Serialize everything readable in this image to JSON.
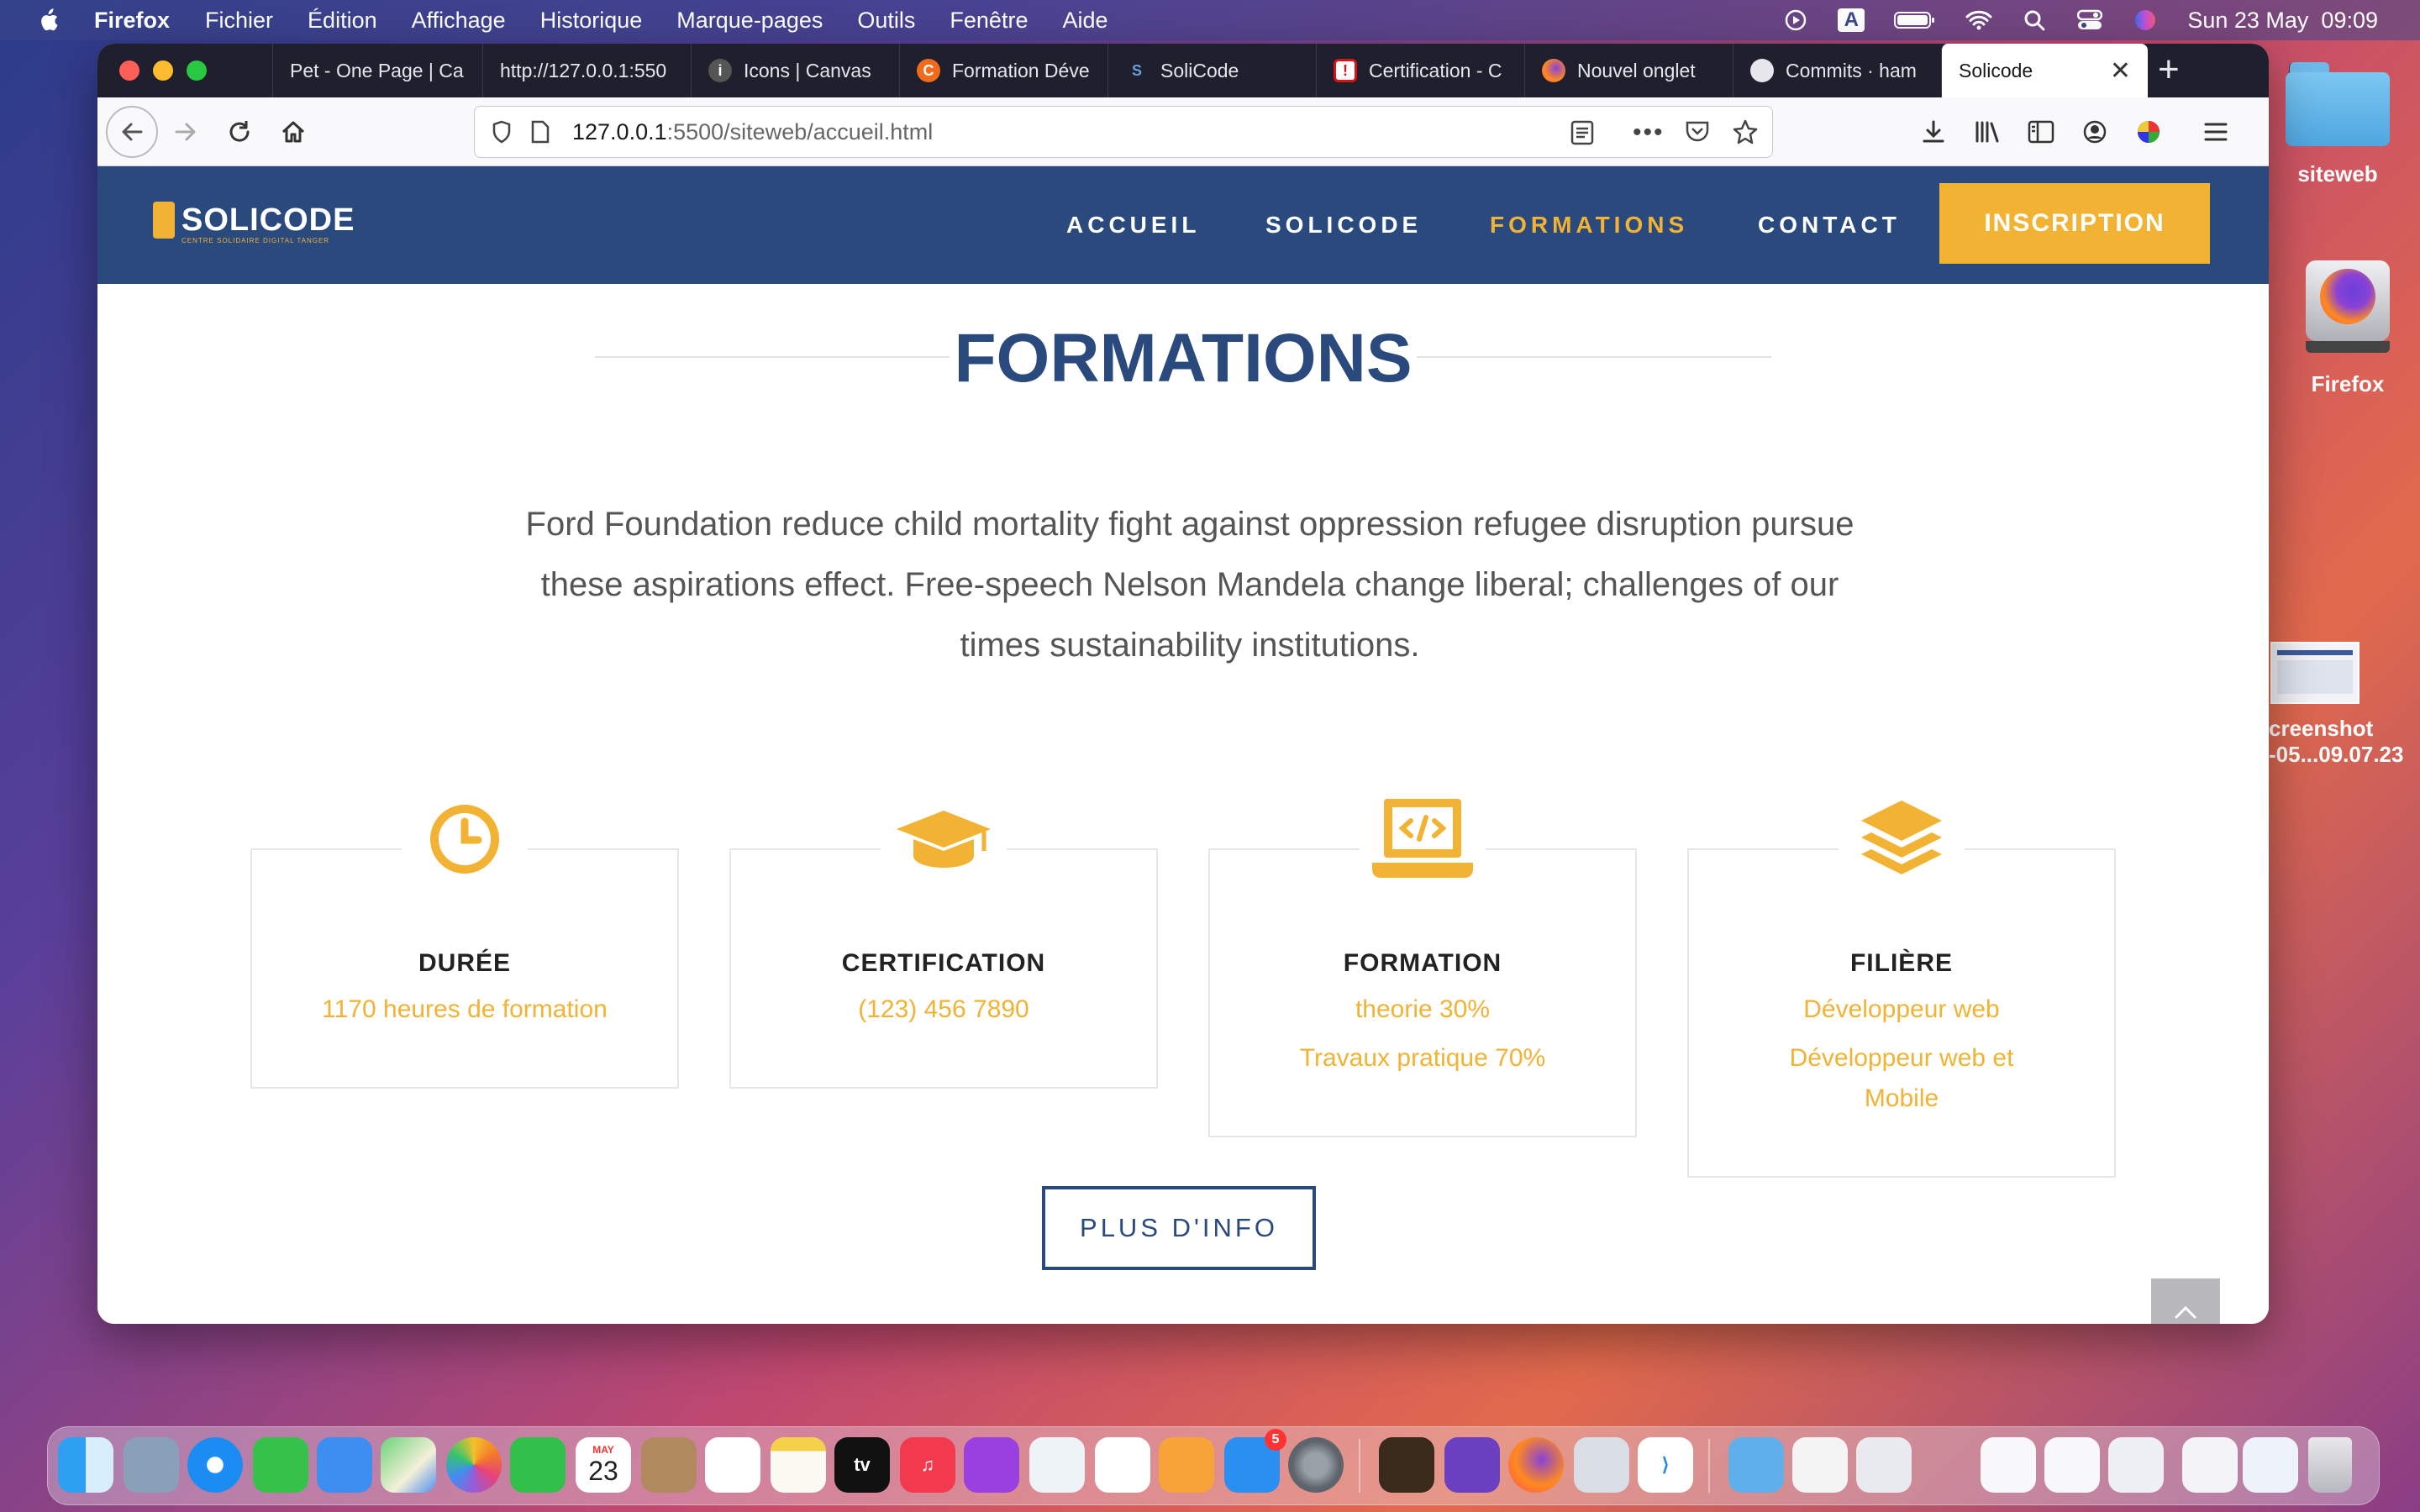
{
  "menubar": {
    "app": "Firefox",
    "items": [
      "Fichier",
      "Édition",
      "Affichage",
      "Historique",
      "Marque-pages",
      "Outils",
      "Fenêtre",
      "Aide"
    ],
    "datetime": "Sun 23 May  09:09",
    "input_source": "A"
  },
  "desktop": {
    "folder_label": "siteweb",
    "firefox_label": "Firefox",
    "screenshot_label_1": "creenshot",
    "screenshot_label_2": "-05...09.07.23"
  },
  "browser": {
    "tabs": [
      {
        "title": "Pet - One Page | Ca"
      },
      {
        "title": "http://127.0.0.1:550"
      },
      {
        "title": "Icons | Canvas"
      },
      {
        "title": "Formation Déve"
      },
      {
        "title": "SoliCode"
      },
      {
        "title": "Certification - C"
      },
      {
        "title": "Nouvel onglet"
      },
      {
        "title": "Commits · ham"
      },
      {
        "title": "Solicode"
      }
    ],
    "url_host": "127.0.0.1",
    "url_rest": ":5500/siteweb/accueil.html"
  },
  "site": {
    "logo_text": "SOLICODE",
    "logo_sub": "CENTRE SOLIDAIRE DIGITAL TANGER",
    "nav": [
      "ACCUEIL",
      "SOLICODE",
      "FORMATIONS",
      "CONTACT"
    ],
    "nav_active_index": 2,
    "cta": "INSCRIPTION",
    "section_title": "FORMATIONS",
    "intro_lines": [
      "Ford Foundation reduce child mortality fight against oppression refugee disruption pursue",
      "these aspirations effect. Free-speech Nelson Mandela change liberal; challenges of our",
      "times sustainability institutions."
    ],
    "cards": [
      {
        "icon": "clock-icon",
        "title": "DURÉE",
        "lines": [
          "1170 heures de formation"
        ]
      },
      {
        "icon": "graduation-cap-icon",
        "title": "CERTIFICATION",
        "lines": [
          "(123) 456 7890"
        ]
      },
      {
        "icon": "laptop-code-icon",
        "title": "FORMATION",
        "lines": [
          "theorie 30%",
          "Travaux pratique 70%"
        ]
      },
      {
        "icon": "layers-icon",
        "title": "FILIÈRE",
        "lines": [
          "Développeur web",
          "Développeur web et Mobile"
        ]
      }
    ],
    "more_button": "PLUS D'INFO"
  },
  "dock": {
    "calendar_month": "MAY",
    "calendar_day": "23",
    "appstore_badge": "5",
    "tv_label": "tv"
  },
  "colors": {
    "brand_blue": "#2a4a7e",
    "accent_gold": "#f2b233"
  }
}
